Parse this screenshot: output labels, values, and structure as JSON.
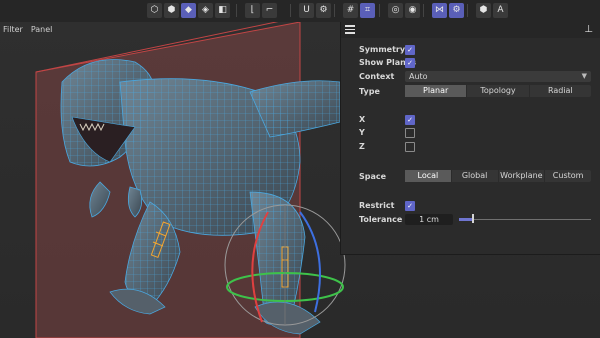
{
  "toolbar": {
    "buttons": [
      {
        "name": "model-mode-icon",
        "glyph": "⬡",
        "active": false
      },
      {
        "name": "object-mode-icon",
        "glyph": "⬢",
        "active": false
      },
      {
        "name": "points-mode-icon",
        "glyph": "◆",
        "active": true
      },
      {
        "name": "edges-mode-icon",
        "glyph": "◈",
        "active": false
      },
      {
        "name": "polygons-mode-icon",
        "glyph": "◧",
        "active": false
      },
      {
        "name": "axis-mode-icon",
        "glyph": "⌊",
        "active": false
      },
      {
        "name": "uv-mode-icon",
        "glyph": "⌐",
        "active": false
      },
      {
        "name": "snap-icon",
        "glyph": "U",
        "active": false
      },
      {
        "name": "snap-settings-icon",
        "glyph": "⚙",
        "active": false
      },
      {
        "name": "workplane-icon",
        "glyph": "#",
        "active": false
      },
      {
        "name": "locked-workplane-icon",
        "glyph": "⌗",
        "active": true
      },
      {
        "name": "soft-selection-icon",
        "glyph": "◎",
        "active": false
      },
      {
        "name": "viewport-solo-icon",
        "glyph": "◉",
        "active": false
      },
      {
        "name": "symmetry-icon",
        "glyph": "⋈",
        "active": true
      },
      {
        "name": "symmetry-settings-icon",
        "glyph": "⚙",
        "active": true
      },
      {
        "name": "render-settings-icon",
        "glyph": "⬢",
        "active": false
      },
      {
        "name": "render-icon",
        "glyph": "A",
        "active": false
      }
    ]
  },
  "viewport": {
    "menu": [
      "Filter",
      "Panel"
    ]
  },
  "panel": {
    "symmetry": {
      "label": "Symmetry",
      "checked": true
    },
    "show_planes": {
      "label": "Show Planes",
      "checked": true
    },
    "context": {
      "label": "Context",
      "value": "Auto"
    },
    "type": {
      "label": "Type",
      "options": [
        "Planar",
        "Topology",
        "Radial"
      ],
      "selected": "Planar"
    },
    "x": {
      "label": "X",
      "checked": true
    },
    "y": {
      "label": "Y",
      "checked": false
    },
    "z": {
      "label": "Z",
      "checked": false
    },
    "space": {
      "label": "Space",
      "options": [
        "Local",
        "Global",
        "Workplane",
        "Custom"
      ],
      "selected": "Local"
    },
    "restrict": {
      "label": "Restrict",
      "checked": true
    },
    "tolerance": {
      "label": "Tolerance",
      "value": "1 cm",
      "slider_fraction": 0.1
    }
  },
  "colors": {
    "accent": "#5a5fb8",
    "wireframe": "#4aa8e0",
    "symmetry_plane": "#c24545",
    "selection": "#f2a531"
  }
}
